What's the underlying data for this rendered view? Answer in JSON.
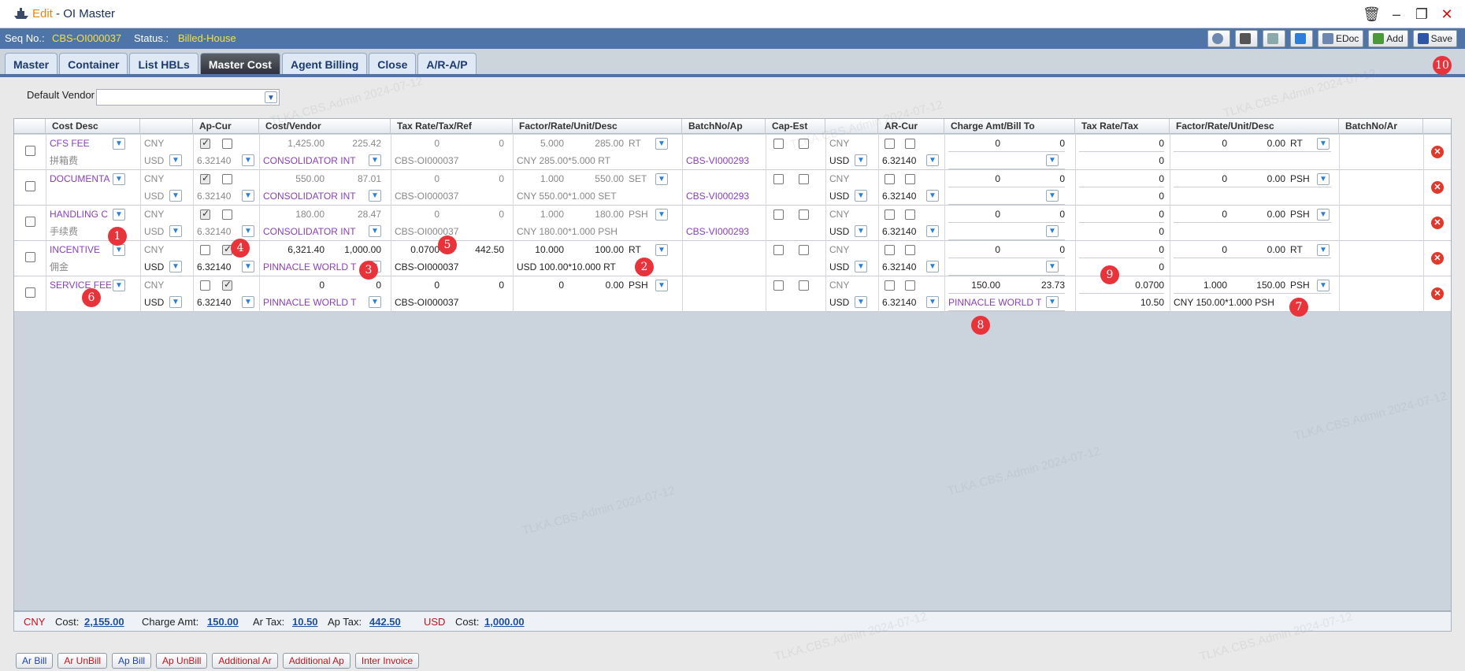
{
  "window": {
    "mode": "Edit",
    "separator": " - ",
    "name": "OI Master"
  },
  "status": {
    "seq_label": "Seq No.:",
    "seq_value": "CBS-OI000037",
    "status_label": "Status.:",
    "status_value": "Billed-House"
  },
  "toolbar": {
    "edoc": "EDoc",
    "add": "Add",
    "save": "Save"
  },
  "tabs": [
    "Master",
    "Container",
    "List HBLs",
    "Master Cost",
    "Agent Billing",
    "Close",
    "A/R-A/P"
  ],
  "default_vendor_label": "Default Vendor",
  "columns": [
    "Cost Desc",
    "Ap-Cur",
    "Cost/Vendor",
    "Tax Rate/Tax/Ref",
    "Factor/Rate/Unit/Desc",
    "BatchNo/Ap",
    "Cap-Est",
    "AR-Cur",
    "Charge Amt/Bill To",
    "Tax Rate/Tax",
    "Factor/Rate/Unit/Desc",
    "BatchNo/Ar"
  ],
  "rows": [
    {
      "desc": "CFS FEE",
      "desc2": "拼箱费",
      "cur1": "CNY",
      "cur2": "USD",
      "ex": "6.32140",
      "cost": "1,425.00",
      "cost2": "225.42",
      "vendor": "CONSOLIDATOR INT",
      "rate": "0",
      "tax": "0",
      "ref": "CBS-OI000037",
      "factor": "5.000",
      "frate": "285.00",
      "unit": "RT",
      "fdesc": "CNY 285.00*5.000 RT",
      "batch": "CBS-VI000293",
      "arcur": "CNY",
      "arcur2": "USD",
      "arex": "6.32140",
      "amt": "0",
      "amt2": "0",
      "billto": "",
      "trate": "0",
      "ttax": "0",
      "rfactor": "0",
      "rrate": "0.00",
      "runit": "RT",
      "rdesc": ""
    },
    {
      "desc": "DOCUMENTA",
      "desc2": "",
      "cur1": "CNY",
      "cur2": "USD",
      "ex": "6.32140",
      "cost": "550.00",
      "cost2": "87.01",
      "vendor": "CONSOLIDATOR INT",
      "rate": "0",
      "tax": "0",
      "ref": "CBS-OI000037",
      "factor": "1.000",
      "frate": "550.00",
      "unit": "SET",
      "fdesc": "CNY 550.00*1.000 SET",
      "batch": "CBS-VI000293",
      "arcur": "CNY",
      "arcur2": "USD",
      "arex": "6.32140",
      "amt": "0",
      "amt2": "0",
      "billto": "",
      "trate": "0",
      "ttax": "0",
      "rfactor": "0",
      "rrate": "0.00",
      "runit": "PSH",
      "rdesc": ""
    },
    {
      "desc": "HANDLING C",
      "desc2": "手续费",
      "cur1": "CNY",
      "cur2": "USD",
      "ex": "6.32140",
      "cost": "180.00",
      "cost2": "28.47",
      "vendor": "CONSOLIDATOR INT",
      "rate": "0",
      "tax": "0",
      "ref": "CBS-OI000037",
      "factor": "1.000",
      "frate": "180.00",
      "unit": "PSH",
      "fdesc": "CNY 180.00*1.000 PSH",
      "batch": "CBS-VI000293",
      "arcur": "CNY",
      "arcur2": "USD",
      "arex": "6.32140",
      "amt": "0",
      "amt2": "0",
      "billto": "",
      "trate": "0",
      "ttax": "0",
      "rfactor": "0",
      "rrate": "0.00",
      "runit": "PSH",
      "rdesc": ""
    },
    {
      "desc": "INCENTIVE",
      "desc2": "佣金",
      "cur1": "CNY",
      "cur2": "USD",
      "ex": "6.32140",
      "cost": "6,321.40",
      "cost2": "1,000.00",
      "vendor": "PINNACLE WORLD T",
      "rate": "0.0700",
      "tax": "442.50",
      "ref": "CBS-OI000037",
      "factor": "10.000",
      "frate": "100.00",
      "unit": "RT",
      "fdesc": "USD 100.00*10.000 RT",
      "batch": "",
      "arcur": "CNY",
      "arcur2": "USD",
      "arex": "6.32140",
      "amt": "0",
      "amt2": "0",
      "billto": "",
      "trate": "0",
      "ttax": "0",
      "rfactor": "0",
      "rrate": "0.00",
      "runit": "RT",
      "rdesc": ""
    },
    {
      "desc": "SERVICE FEE",
      "desc2": "",
      "cur1": "CNY",
      "cur2": "USD",
      "ex": "6.32140",
      "cost": "0",
      "cost2": "0",
      "vendor": "PINNACLE WORLD T",
      "rate": "0",
      "tax": "0",
      "ref": "CBS-OI000037",
      "factor": "0",
      "frate": "0.00",
      "unit": "PSH",
      "fdesc": "",
      "batch": "",
      "arcur": "CNY",
      "arcur2": "USD",
      "arex": "6.32140",
      "amt": "150.00",
      "amt2": "23.73",
      "billto": "PINNACLE WORLD T",
      "trate": "0.0700",
      "ttax": "10.50",
      "rfactor": "1.000",
      "rrate": "150.00",
      "runit": "PSH",
      "rdesc": "CNY 150.00*1.000 PSH"
    }
  ],
  "footer": {
    "cny": "CNY",
    "cost_label": "Cost:",
    "cost": "2,155.00",
    "charge_label": "Charge Amt:",
    "charge": "150.00",
    "artax_label": "Ar Tax:",
    "artax": "10.50",
    "aptax_label": "Ap Tax:",
    "aptax": "442.50",
    "usd": "USD",
    "usd_cost_label": "Cost:",
    "usd_cost": "1,000.00"
  },
  "actions": [
    "Ar Bill",
    "Ar UnBill",
    "Ap Bill",
    "Ap UnBill",
    "Additional Ar",
    "Additional Ap",
    "Inter Invoice"
  ],
  "markers": [
    "1",
    "2",
    "3",
    "4",
    "5",
    "6",
    "7",
    "8",
    "9",
    "10"
  ],
  "watermark": "TLKA.CBS.Admin 2024-07-12"
}
